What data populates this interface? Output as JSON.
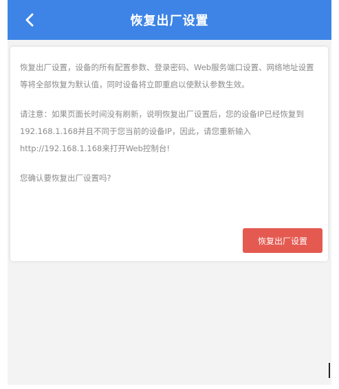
{
  "header": {
    "title": "恢复出厂设置",
    "back_icon": "chevron-left-icon"
  },
  "content": {
    "paragraph1": "恢复出厂设置，设备的所有配置参数、登录密码、Web服务端口设置、网络地址设置等将全部恢复为默认值，同时设备将立即重启以使默认参数生效。",
    "paragraph2": "请注意：如果页面长时间没有刷新，说明恢复出厂设置后，您的设备IP已经恢复到192.168.1.168并且不同于您当前的设备IP，因此，请您重新输入http://192.168.1.168来打开Web控制台!",
    "confirm_question": "您确认要恢复出厂设置吗?",
    "reset_button_label": "恢复出厂设置"
  },
  "colors": {
    "header_bg": "#3d84e6",
    "button_bg": "#e45a51",
    "page_bg": "#f3f3f3",
    "text": "#8a8a8a"
  }
}
